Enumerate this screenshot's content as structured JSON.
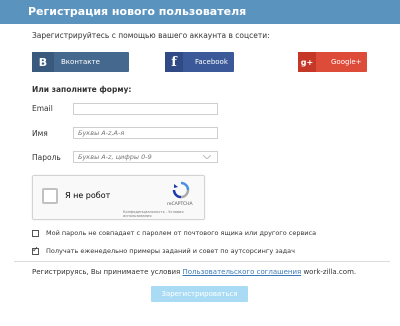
{
  "header": {
    "title": "Регистрация нового пользователя"
  },
  "social": {
    "label": "Зарегистрируйтесь с помощью вашего аккаунта в соцсети:",
    "buttons": [
      {
        "name": "vk",
        "icon_glyph": "В",
        "label": "Вконтакте",
        "color": "#45688e"
      },
      {
        "name": "facebook",
        "icon_glyph": "f",
        "label": "Facebook",
        "color": "#3b5998"
      },
      {
        "name": "google",
        "icon_glyph": "g+",
        "label": "Google+",
        "color": "#dd4b39"
      }
    ]
  },
  "form": {
    "heading": "Или заполните форму:",
    "fields": [
      {
        "label": "Email",
        "value": ""
      },
      {
        "label": "Имя",
        "placeholder": "Буквы A-z,А-я"
      },
      {
        "label": "Пароль",
        "placeholder": "Буквы A-z, цифры 0-9",
        "icon": "chevron-down-icon"
      }
    ]
  },
  "captcha": {
    "label": "Я не робот",
    "brand": "reCAPTCHA",
    "terms": "Конфиденциальность - Условия использования"
  },
  "checkboxes": [
    {
      "label": "Мой пароль не совпадает с паролем от почтового ящика или другого сервиса",
      "checked": false
    },
    {
      "label": "Получать еженедельно примеры заданий и совет по аутсорсингу задач",
      "checked": true,
      "mark": "✓"
    }
  ],
  "terms": {
    "prefix": "Регистрируясь, Вы принимаете условия ",
    "link": "Пользовательского соглашения",
    "suffix": " work-zilla.com."
  },
  "submit": {
    "label": "Зарегистрироваться"
  },
  "colors": {
    "header_bg": "#5b93bf",
    "link": "#3a78b6",
    "submit_bg": "#a9dcf4"
  }
}
